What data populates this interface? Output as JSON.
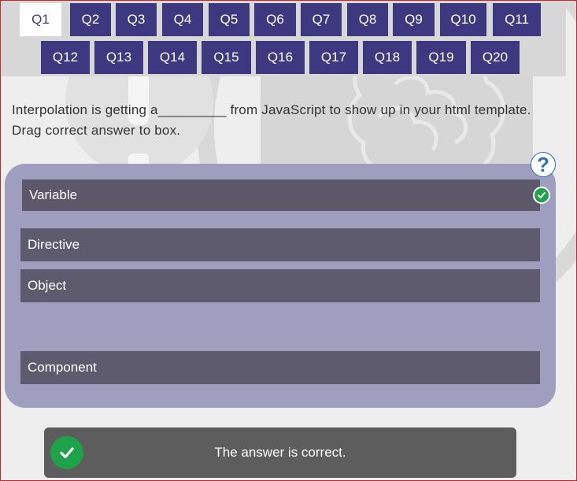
{
  "tabs": [
    "Q1",
    "Q2",
    "Q3",
    "Q4",
    "Q5",
    "Q6",
    "Q7",
    "Q8",
    "Q9",
    "Q10",
    "Q11",
    "Q12",
    "Q13",
    "Q14",
    "Q15",
    "Q16",
    "Q17",
    "Q18",
    "Q19",
    "Q20"
  ],
  "active_tab": "Q1",
  "question": "Interpolation is getting a_________ from JavaScript to show up in your html template. Drag correct answer to box.",
  "help": "?",
  "dropped_answer": "Variable",
  "answers": [
    "Directive",
    "Object",
    "Component"
  ],
  "feedback": "The answer is correct.",
  "icons": {
    "help": "help-icon",
    "check": "check-icon"
  },
  "colors": {
    "tab_bg": "#3e3880",
    "active_tab_bg": "#ffffff",
    "panel_bg": "#a09ebe",
    "answer_bg": "#5f5b6e",
    "correct": "#1ea34a",
    "feedback_bg": "#5d5d5d"
  }
}
